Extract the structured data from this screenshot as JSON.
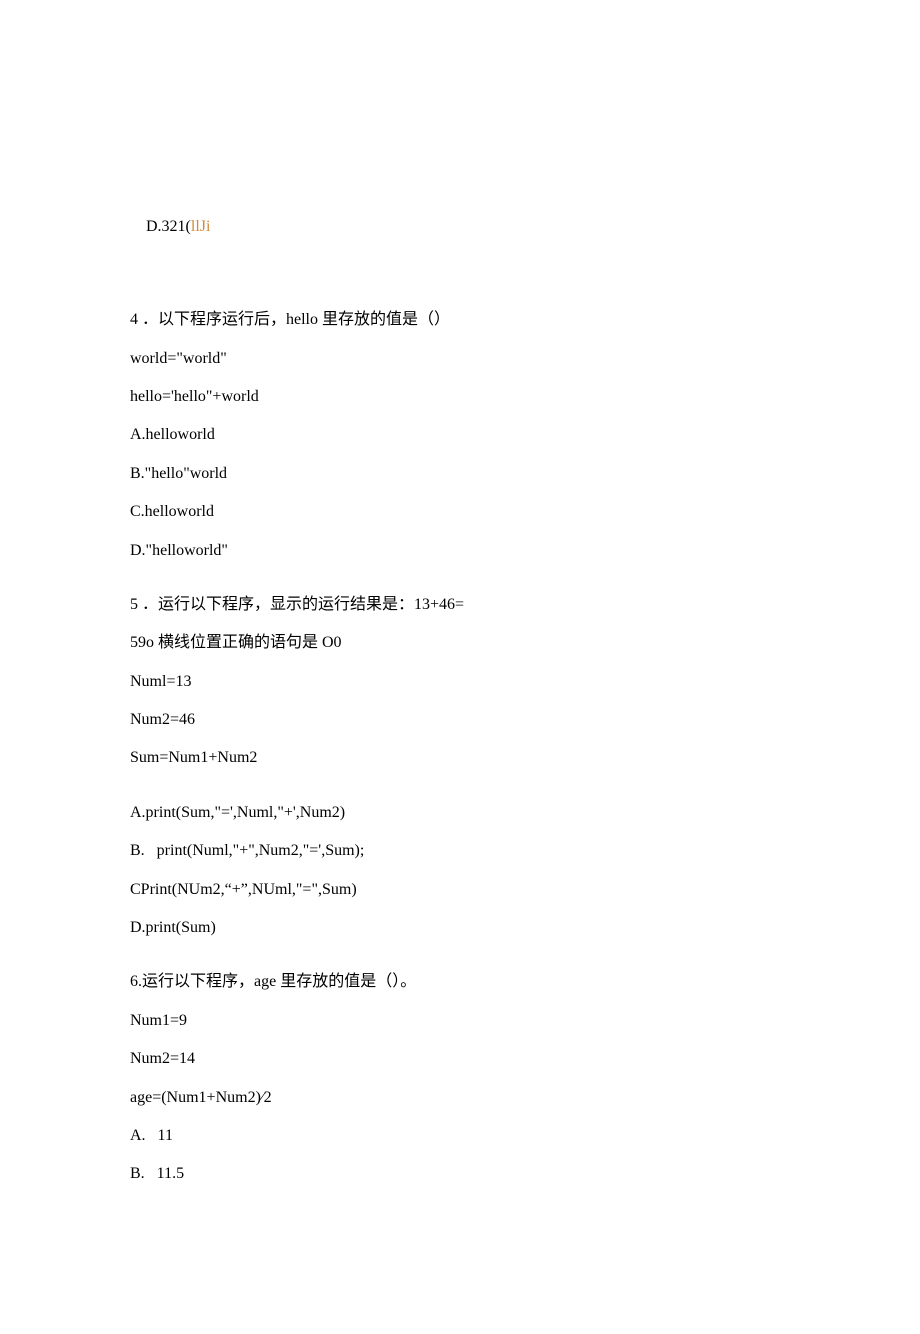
{
  "q3": {
    "optD_pre": "D.321(",
    "optD_link": "llJi"
  },
  "q4": {
    "stem1": "4 ．以下程序运行后，hello 里存放的值是（）",
    "code1": "world=\"world\"",
    "code2": "hello='hello\"+world",
    "optA": "A.helloworld",
    "optB": "B.\"hello\"world",
    "optC": "C.helloworld",
    "optD": "D.\"helloworld\""
  },
  "q5": {
    "stem1": "5 ．运行以下程序，显示的运行结果是：13+46=",
    "stem2": "59o 横线位置正确的语句是 O0",
    "code1": "Numl=13",
    "code2": "Num2=46",
    "code3": "Sum=Num1+Num2",
    "optA": "A.print(Sum,\"=',Numl,\"+',Num2)",
    "optB": "B.   print(Numl,\"+\",Num2,\"=',Sum);",
    "optC": "CPrint(NUm2,“+”,NUml,\"=\",Sum)",
    "optD": "D.print(Sum)"
  },
  "q6": {
    "stem1": "6.运行以下程序，age 里存放的值是（）。",
    "code1": "Num1=9",
    "code2": "Num2=14",
    "code3": "age=(Num1+Num2)∕2",
    "optA": "A.   11",
    "optB": "B.   11.5"
  }
}
